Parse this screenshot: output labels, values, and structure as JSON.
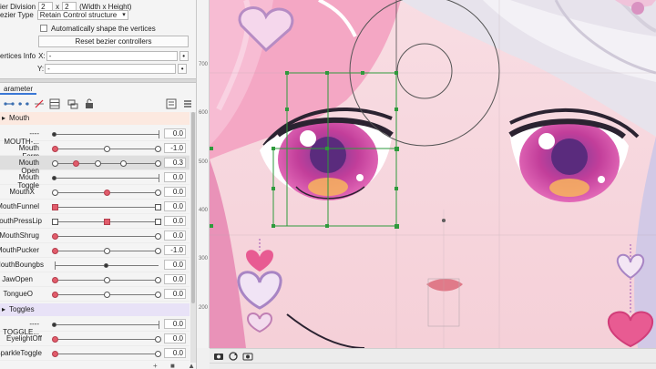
{
  "mesh": {
    "division_label": "ier Division",
    "division_x": "2",
    "division_x_sep": "x",
    "division_y": "2",
    "division_hint": "(Width x Height)",
    "bezier_type_label": "ezier Type",
    "bezier_type_value": "Retain Control structure",
    "auto_shape_label": "Automatically shape the vertices",
    "reset_button": "Reset bezier controllers",
    "vertices_label": "ertices Info",
    "vx_label": "X:",
    "vy_label": "Y:",
    "vx_value": "-",
    "vy_value": "-"
  },
  "parameter_tab": "arameter",
  "groups": [
    {
      "name": "Mouth"
    },
    {
      "name": "Toggles"
    }
  ],
  "parameters": [
    {
      "name": "----MOUTH-...",
      "value": "0.0"
    },
    {
      "name": "Mouth Form",
      "value": "-1.0"
    },
    {
      "name": "Mouth Open",
      "value": "0.3"
    },
    {
      "name": "Mouth Toggle",
      "value": "0.0"
    },
    {
      "name": "MouthX",
      "value": "0.0"
    },
    {
      "name": "MouthFunnel",
      "value": "0.0"
    },
    {
      "name": "MouthPressLip",
      "value": "0.0"
    },
    {
      "name": "MouthShrug",
      "value": "0.0"
    },
    {
      "name": "MouthPucker",
      "value": "-1.0"
    },
    {
      "name": "MouthBoungbs",
      "value": "0.0"
    },
    {
      "name": "JawOpen",
      "value": "0.0"
    },
    {
      "name": "TongueO",
      "value": "0.0"
    },
    {
      "name": "----TOGGLE...",
      "value": "0.0"
    },
    {
      "name": "EyelightOff",
      "value": "0.0"
    },
    {
      "name": "SparkleToggle",
      "value": "0.0"
    }
  ],
  "ruler": [
    "700",
    "600",
    "500",
    "400",
    "300",
    "200"
  ],
  "colors": {
    "accent_red": "#e15c6b",
    "mesh_green": "#2e9a3c",
    "hair_pink": "#f4a7c4",
    "eye_magenta": "#d5449b"
  }
}
